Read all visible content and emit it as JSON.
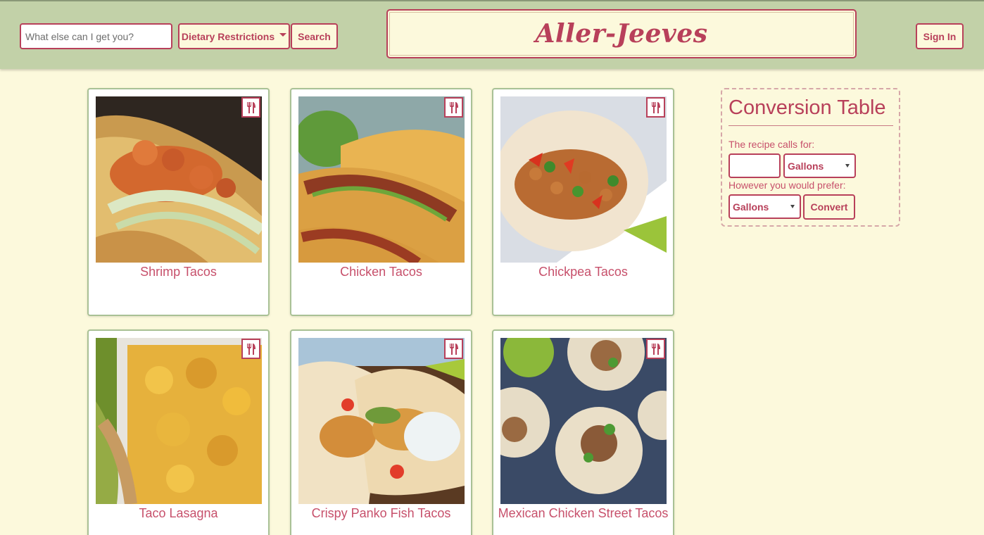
{
  "header": {
    "search_placeholder": "What else can I get you?",
    "dietary_label": "Dietary Restrictions",
    "search_label": "Search",
    "brand": "Aller-Jeeves",
    "signin_label": "Sign In"
  },
  "recipes": [
    {
      "title": "Shrimp Tacos"
    },
    {
      "title": "Chicken Tacos"
    },
    {
      "title": "Chickpea Tacos"
    },
    {
      "title": "Taco Lasagna"
    },
    {
      "title": "Crispy Panko Fish Tacos"
    },
    {
      "title": "Mexican Chicken Street Tacos"
    }
  ],
  "conversion": {
    "title": "Conversion Table",
    "calls_for_label": "The recipe calls for:",
    "amount_value": "",
    "from_unit": "Gallons",
    "prefer_label": "However you would prefer:",
    "to_unit": "Gallons",
    "convert_label": "Convert"
  },
  "icons": {
    "favorite": "utensils-icon",
    "dropdown": "caret-down-icon"
  },
  "colors": {
    "accent": "#b8405a",
    "header_bg": "#c2d1a8",
    "page_bg": "#fcf9dc",
    "card_border": "#a9c195"
  }
}
